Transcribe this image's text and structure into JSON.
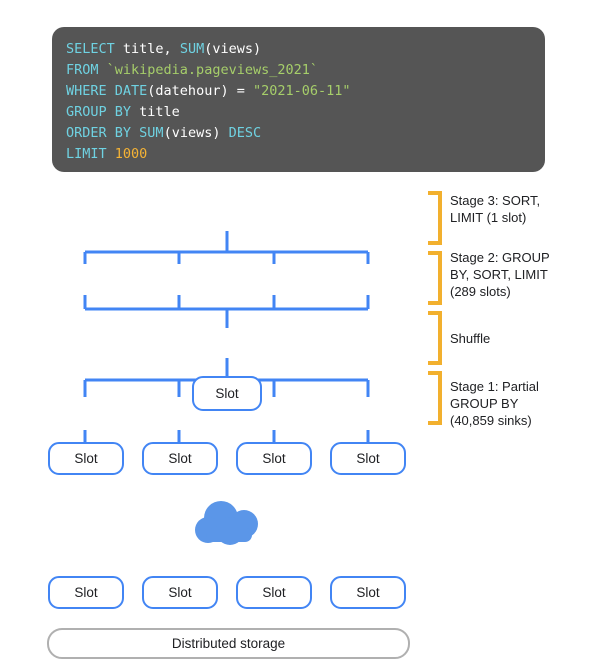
{
  "code_panel": {
    "language": "sql",
    "background_color": "#555555",
    "keyword_color": "#6FD2E2",
    "string_color": "#A6CE6A",
    "number_color": "#F5B335",
    "plain_color": "#FFFFFF",
    "lines": [
      [
        {
          "t": "SELECT",
          "c": "kw"
        },
        {
          "t": " title, ",
          "c": "pln"
        },
        {
          "t": "SUM",
          "c": "kw"
        },
        {
          "t": "(views)",
          "c": "pln"
        }
      ],
      [
        {
          "t": "FROM",
          "c": "kw"
        },
        {
          "t": " ",
          "c": "pln"
        },
        {
          "t": "`wikipedia.pageviews_2021`",
          "c": "str"
        }
      ],
      [
        {
          "t": "WHERE",
          "c": "kw"
        },
        {
          "t": " ",
          "c": "pln"
        },
        {
          "t": "DATE",
          "c": "kw"
        },
        {
          "t": "(datehour) = ",
          "c": "pln"
        },
        {
          "t": "\"2021-06-11\"",
          "c": "str"
        }
      ],
      [
        {
          "t": "GROUP BY",
          "c": "kw"
        },
        {
          "t": " title",
          "c": "pln"
        }
      ],
      [
        {
          "t": "ORDER BY",
          "c": "kw"
        },
        {
          "t": " ",
          "c": "pln"
        },
        {
          "t": "SUM",
          "c": "kw"
        },
        {
          "t": "(views) ",
          "c": "pln"
        },
        {
          "t": "DESC",
          "c": "kw"
        }
      ],
      [
        {
          "t": "LIMIT",
          "c": "kw"
        },
        {
          "t": " ",
          "c": "pln"
        },
        {
          "t": "1000",
          "c": "num"
        }
      ]
    ],
    "plain_text": "SELECT title, SUM(views)\nFROM `wikipedia.pageviews_2021`\nWHERE DATE(datehour) = \"2021-06-11\"\nGROUP BY title\nORDER BY SUM(views) DESC\nLIMIT 1000"
  },
  "diagram": {
    "slot_label": "Slot",
    "slot_border_color": "#4285F4",
    "connector_color": "#4285F4",
    "cloud_color": "#5B96E8",
    "storage_label": "Distributed storage",
    "storage_border_color": "#B0B0B0",
    "top_row": {
      "count": 1,
      "labels": [
        "Slot"
      ]
    },
    "middle_row": {
      "count": 4,
      "labels": [
        "Slot",
        "Slot",
        "Slot",
        "Slot"
      ]
    },
    "bottom_row": {
      "count": 4,
      "labels": [
        "Slot",
        "Slot",
        "Slot",
        "Slot"
      ]
    }
  },
  "legend": {
    "bracket_color": "#F2B02E",
    "items": [
      {
        "id": "stage-3",
        "text": "Stage 3: SORT,\nLIMIT (1 slot)"
      },
      {
        "id": "stage-2",
        "text": "Stage 2: GROUP\nBY, SORT, LIMIT\n(289 slots)"
      },
      {
        "id": "shuffle",
        "text": "Shuffle"
      },
      {
        "id": "stage-1",
        "text": "Stage 1: Partial\nGROUP BY\n(40,859 sinks)"
      }
    ]
  }
}
